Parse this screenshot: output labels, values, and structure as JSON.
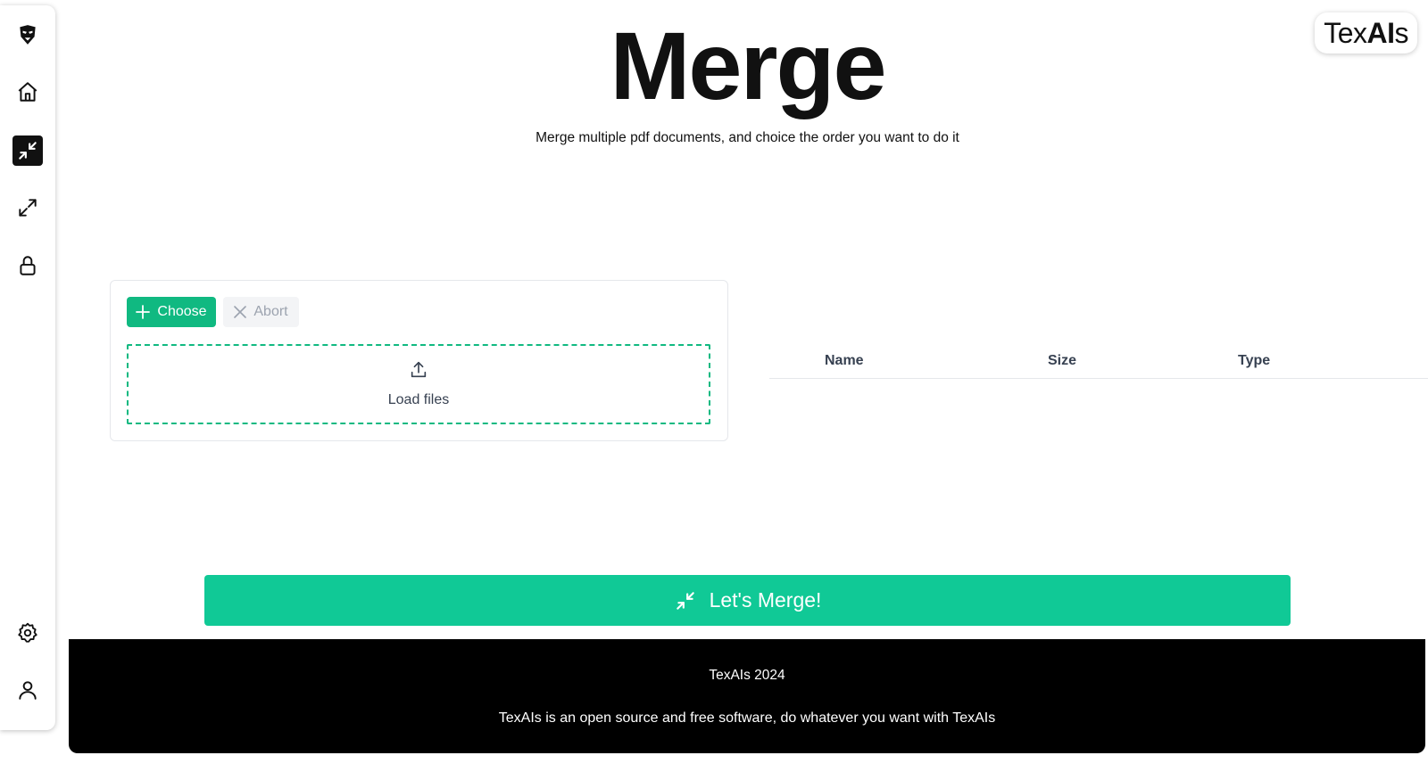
{
  "header": {
    "title": "Merge",
    "subtitle": "Merge multiple pdf documents, and choice the order you want to do it"
  },
  "brand": {
    "prefix": "Tex",
    "strong": "AI",
    "suffix": "s"
  },
  "sidebar": {
    "items": [
      {
        "icon": "mask-logo-icon"
      },
      {
        "icon": "home-icon"
      },
      {
        "icon": "merge-icon",
        "active": true
      },
      {
        "icon": "split-icon"
      },
      {
        "icon": "lock-icon"
      },
      {
        "icon": "gear-icon"
      },
      {
        "icon": "user-icon"
      }
    ]
  },
  "upload": {
    "choose_label": "Choose",
    "abort_label": "Abort",
    "dropzone_label": "Load files"
  },
  "table": {
    "columns": [
      "Name",
      "Size",
      "Type"
    ]
  },
  "action": {
    "merge_label": "Let's Merge!"
  },
  "footer": {
    "title": "TexAIs 2024",
    "note": "TexAIs is an open source and free software, do whatever you want with TexAIs"
  },
  "colors": {
    "accent": "#10b981",
    "merge_button": "#10c996",
    "footer_bg": "#000000"
  }
}
